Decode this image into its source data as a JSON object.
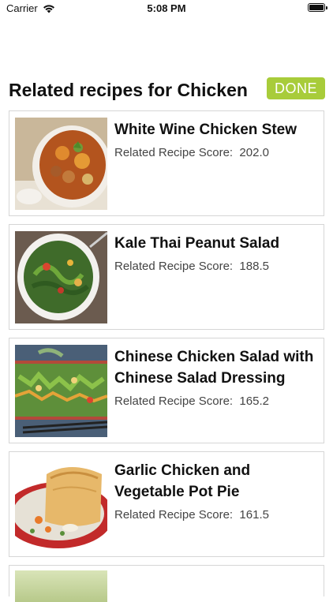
{
  "status_bar": {
    "carrier": "Carrier",
    "time": "5:08 PM"
  },
  "header": {
    "title": "Related recipes for Chicken",
    "done_label": "DONE"
  },
  "colors": {
    "done_button": "#a8cc3a",
    "card_border": "#d6d6d6"
  },
  "recipes": [
    {
      "title": "White Wine Chicken Stew",
      "score_text": "Related Recipe Score:  202.0",
      "image_icon": "stew-bowl-photo"
    },
    {
      "title": "Kale Thai Peanut Salad",
      "score_text": "Related Recipe Score:  188.5",
      "image_icon": "salad-bowl-photo"
    },
    {
      "title": "Chinese Chicken Salad with Chinese Salad Dressing",
      "score_text": "Related Recipe Score:  165.2",
      "image_icon": "salad-platter-photo"
    },
    {
      "title": "Garlic Chicken and Vegetable Pot Pie",
      "score_text": "Related Recipe Score:  161.5",
      "image_icon": "pot-pie-photo"
    }
  ]
}
